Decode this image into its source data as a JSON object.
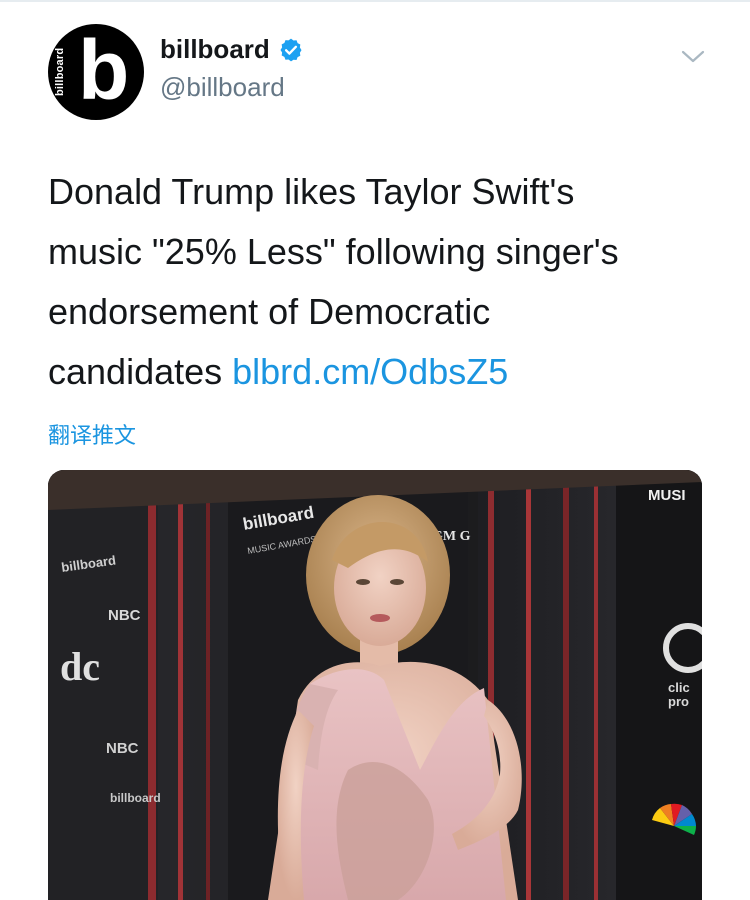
{
  "account": {
    "avatar_side_text": "billboard",
    "avatar_mark": "b",
    "name": "billboard",
    "handle": "@billboard",
    "verified": true
  },
  "tweet": {
    "text_lines": [
      "Donald Trump likes Taylor Swift's",
      "music \"25% Less\" following singer's",
      "endorsement of Democratic",
      "candidates "
    ],
    "link": "blbrd.cm/OdbsZ5",
    "translate_label": "翻译推文"
  },
  "photo": {
    "backdrop_texts": [
      "billboard",
      "MUSIC AWARDS",
      "MGM G",
      "MUSI",
      "NBC",
      "dc",
      "clic",
      "pro"
    ]
  },
  "icons": {
    "verified": "verified-badge-icon",
    "caret": "chevron-down-icon"
  },
  "colors": {
    "link": "#1b95e0",
    "verified": "#1da1f2",
    "handle": "#657786",
    "text": "#14171a"
  }
}
